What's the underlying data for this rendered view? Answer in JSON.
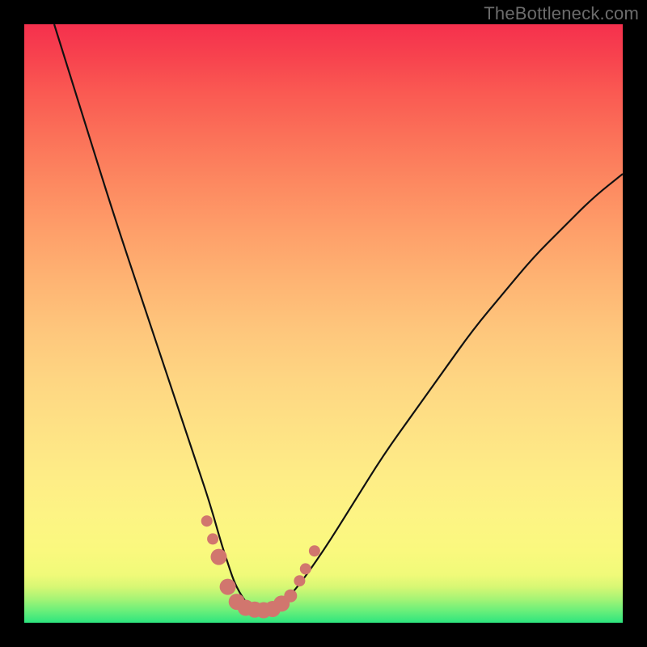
{
  "watermark": "TheBottleneck.com",
  "chart_data": {
    "type": "line",
    "title": "",
    "xlabel": "",
    "ylabel": "",
    "xlim": [
      0,
      100
    ],
    "ylim": [
      0,
      100
    ],
    "grid": false,
    "series": [
      {
        "name": "curve",
        "x": [
          5,
          10,
          15,
          20,
          25,
          27,
          29,
          31,
          33,
          34,
          35,
          36,
          37,
          38,
          40,
          42,
          45,
          50,
          55,
          60,
          65,
          70,
          75,
          80,
          85,
          90,
          95,
          100
        ],
        "values": [
          100,
          84,
          68,
          53,
          38,
          32,
          26,
          20,
          13,
          10,
          7,
          5,
          3.5,
          2.5,
          2,
          2.5,
          5,
          12,
          20,
          28,
          35,
          42,
          49,
          55,
          61,
          66,
          71,
          75
        ]
      }
    ],
    "markers": [
      {
        "x": 30.5,
        "y": 17,
        "r": 7
      },
      {
        "x": 31.5,
        "y": 14,
        "r": 7
      },
      {
        "x": 32.5,
        "y": 11,
        "r": 10
      },
      {
        "x": 34.0,
        "y": 6,
        "r": 10
      },
      {
        "x": 35.5,
        "y": 3.5,
        "r": 10
      },
      {
        "x": 37.0,
        "y": 2.5,
        "r": 10
      },
      {
        "x": 38.5,
        "y": 2.2,
        "r": 10
      },
      {
        "x": 40.0,
        "y": 2.1,
        "r": 10
      },
      {
        "x": 41.5,
        "y": 2.3,
        "r": 10
      },
      {
        "x": 43.0,
        "y": 3.2,
        "r": 10
      },
      {
        "x": 44.5,
        "y": 4.5,
        "r": 8
      },
      {
        "x": 46.0,
        "y": 7,
        "r": 7
      },
      {
        "x": 47.0,
        "y": 9,
        "r": 7
      },
      {
        "x": 48.5,
        "y": 12,
        "r": 7
      }
    ],
    "background_gradient": {
      "direction": "bottom-to-top",
      "colors": [
        "#2de57e",
        "#faf97e",
        "#f5304d"
      ]
    }
  }
}
